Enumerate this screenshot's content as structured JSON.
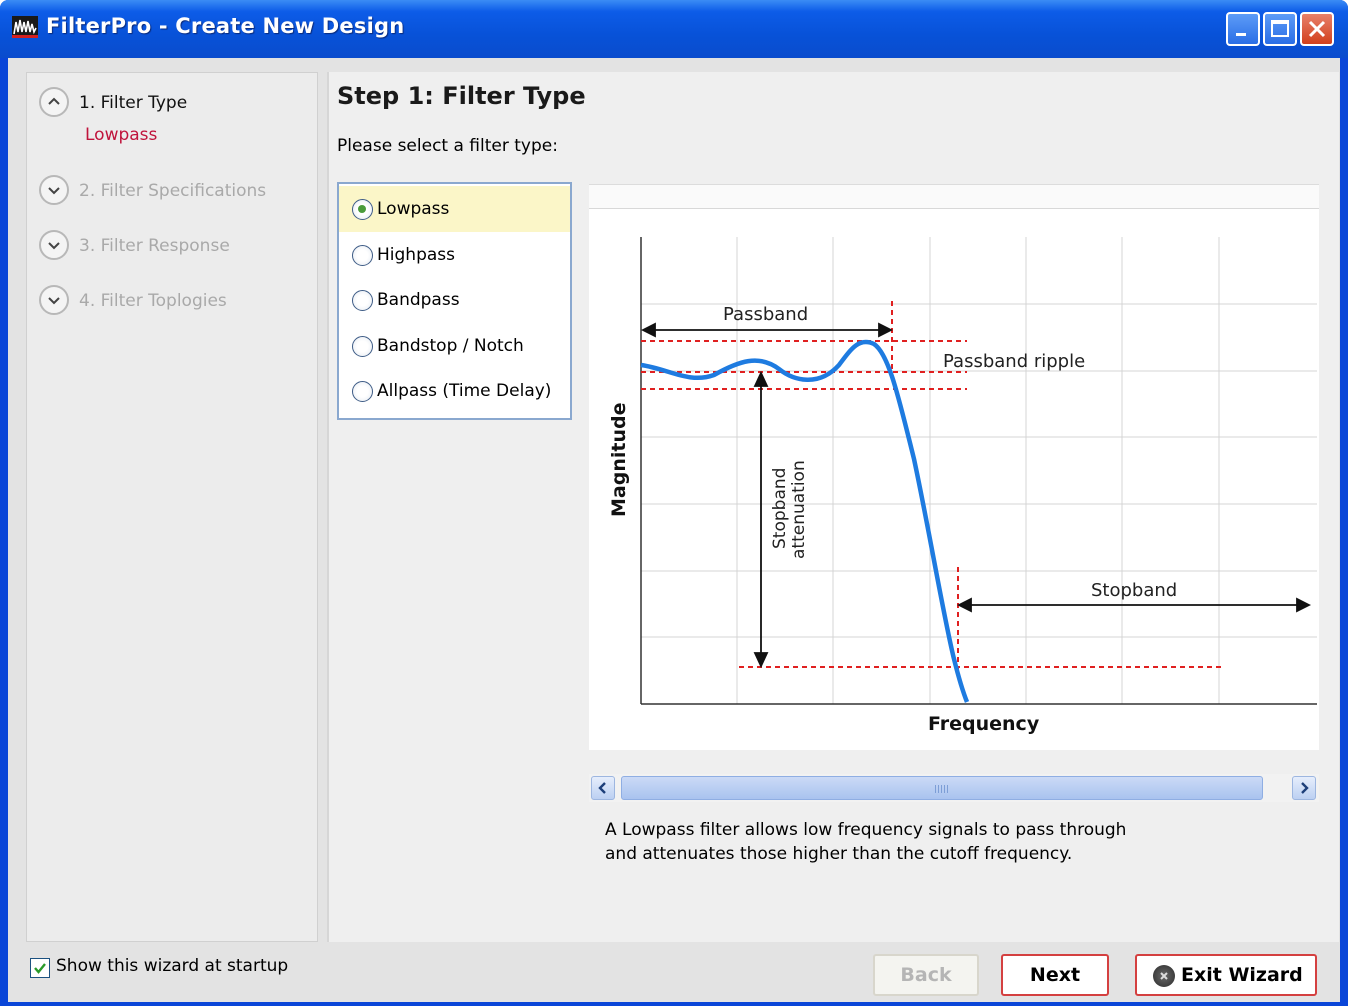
{
  "window": {
    "title": "FilterPro - Create New Design",
    "controls": [
      "minimize-icon",
      "maximize-icon",
      "close-icon"
    ],
    "accent_color": "#0a46d8"
  },
  "sidebar": {
    "steps": [
      {
        "label": "1. Filter Type",
        "state": "expanded",
        "value": "Lowpass"
      },
      {
        "label": "2. Filter Specifications",
        "state": "collapsed"
      },
      {
        "label": "3. Filter Response",
        "state": "collapsed"
      },
      {
        "label": "4. Filter Toplogies",
        "state": "collapsed"
      }
    ]
  },
  "main": {
    "title": "Step 1: Filter Type",
    "prompt": "Please select a filter type:",
    "options": [
      {
        "label": "Lowpass",
        "selected": true
      },
      {
        "label": "Highpass",
        "selected": false
      },
      {
        "label": "Bandpass",
        "selected": false
      },
      {
        "label": "Bandstop / Notch",
        "selected": false
      },
      {
        "label": "Allpass (Time Delay)",
        "selected": false
      }
    ],
    "diagram": {
      "xlabel": "Frequency",
      "ylabel": "Magnitude",
      "annotations": {
        "passband": "Passband",
        "passband_ripple": "Passband ripple",
        "stopband_attenuation_1": "Stopband",
        "stopband_attenuation_2": "attenuation",
        "stopband": "Stopband"
      },
      "curve_color": "#1e7be0",
      "marker_color": "#e02020"
    },
    "description_line1": "A Lowpass filter allows low frequency signals to pass through",
    "description_line2": "and attenuates those higher than the cutoff frequency."
  },
  "footer": {
    "show_at_startup_label": "Show this wizard at startup",
    "show_at_startup_checked": true,
    "back_label": "Back",
    "back_enabled": false,
    "next_label": "Next",
    "exit_label": "Exit Wizard"
  }
}
